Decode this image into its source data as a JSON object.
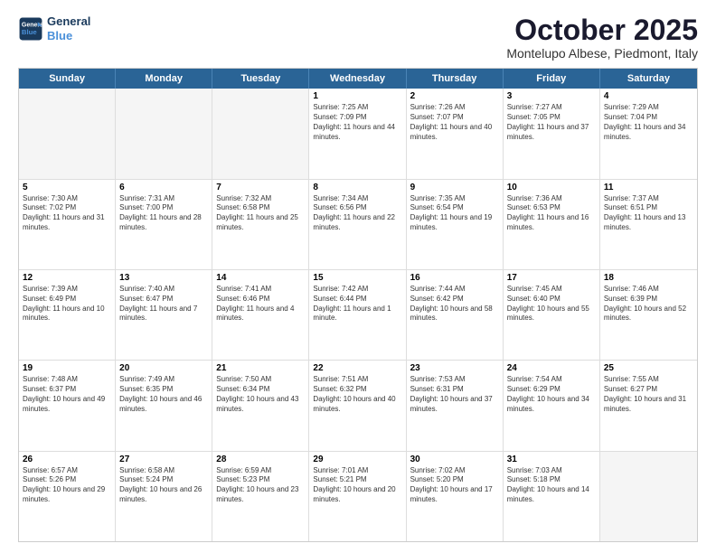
{
  "header": {
    "logo_line1": "General",
    "logo_line2": "Blue",
    "month": "October 2025",
    "location": "Montelupo Albese, Piedmont, Italy"
  },
  "days_of_week": [
    "Sunday",
    "Monday",
    "Tuesday",
    "Wednesday",
    "Thursday",
    "Friday",
    "Saturday"
  ],
  "rows": [
    [
      {
        "day": "",
        "text": "",
        "empty": true
      },
      {
        "day": "",
        "text": "",
        "empty": true
      },
      {
        "day": "",
        "text": "",
        "empty": true
      },
      {
        "day": "1",
        "text": "Sunrise: 7:25 AM\nSunset: 7:09 PM\nDaylight: 11 hours and 44 minutes."
      },
      {
        "day": "2",
        "text": "Sunrise: 7:26 AM\nSunset: 7:07 PM\nDaylight: 11 hours and 40 minutes."
      },
      {
        "day": "3",
        "text": "Sunrise: 7:27 AM\nSunset: 7:05 PM\nDaylight: 11 hours and 37 minutes."
      },
      {
        "day": "4",
        "text": "Sunrise: 7:29 AM\nSunset: 7:04 PM\nDaylight: 11 hours and 34 minutes."
      }
    ],
    [
      {
        "day": "5",
        "text": "Sunrise: 7:30 AM\nSunset: 7:02 PM\nDaylight: 11 hours and 31 minutes."
      },
      {
        "day": "6",
        "text": "Sunrise: 7:31 AM\nSunset: 7:00 PM\nDaylight: 11 hours and 28 minutes."
      },
      {
        "day": "7",
        "text": "Sunrise: 7:32 AM\nSunset: 6:58 PM\nDaylight: 11 hours and 25 minutes."
      },
      {
        "day": "8",
        "text": "Sunrise: 7:34 AM\nSunset: 6:56 PM\nDaylight: 11 hours and 22 minutes."
      },
      {
        "day": "9",
        "text": "Sunrise: 7:35 AM\nSunset: 6:54 PM\nDaylight: 11 hours and 19 minutes."
      },
      {
        "day": "10",
        "text": "Sunrise: 7:36 AM\nSunset: 6:53 PM\nDaylight: 11 hours and 16 minutes."
      },
      {
        "day": "11",
        "text": "Sunrise: 7:37 AM\nSunset: 6:51 PM\nDaylight: 11 hours and 13 minutes."
      }
    ],
    [
      {
        "day": "12",
        "text": "Sunrise: 7:39 AM\nSunset: 6:49 PM\nDaylight: 11 hours and 10 minutes."
      },
      {
        "day": "13",
        "text": "Sunrise: 7:40 AM\nSunset: 6:47 PM\nDaylight: 11 hours and 7 minutes."
      },
      {
        "day": "14",
        "text": "Sunrise: 7:41 AM\nSunset: 6:46 PM\nDaylight: 11 hours and 4 minutes."
      },
      {
        "day": "15",
        "text": "Sunrise: 7:42 AM\nSunset: 6:44 PM\nDaylight: 11 hours and 1 minute."
      },
      {
        "day": "16",
        "text": "Sunrise: 7:44 AM\nSunset: 6:42 PM\nDaylight: 10 hours and 58 minutes."
      },
      {
        "day": "17",
        "text": "Sunrise: 7:45 AM\nSunset: 6:40 PM\nDaylight: 10 hours and 55 minutes."
      },
      {
        "day": "18",
        "text": "Sunrise: 7:46 AM\nSunset: 6:39 PM\nDaylight: 10 hours and 52 minutes."
      }
    ],
    [
      {
        "day": "19",
        "text": "Sunrise: 7:48 AM\nSunset: 6:37 PM\nDaylight: 10 hours and 49 minutes."
      },
      {
        "day": "20",
        "text": "Sunrise: 7:49 AM\nSunset: 6:35 PM\nDaylight: 10 hours and 46 minutes."
      },
      {
        "day": "21",
        "text": "Sunrise: 7:50 AM\nSunset: 6:34 PM\nDaylight: 10 hours and 43 minutes."
      },
      {
        "day": "22",
        "text": "Sunrise: 7:51 AM\nSunset: 6:32 PM\nDaylight: 10 hours and 40 minutes."
      },
      {
        "day": "23",
        "text": "Sunrise: 7:53 AM\nSunset: 6:31 PM\nDaylight: 10 hours and 37 minutes."
      },
      {
        "day": "24",
        "text": "Sunrise: 7:54 AM\nSunset: 6:29 PM\nDaylight: 10 hours and 34 minutes."
      },
      {
        "day": "25",
        "text": "Sunrise: 7:55 AM\nSunset: 6:27 PM\nDaylight: 10 hours and 31 minutes."
      }
    ],
    [
      {
        "day": "26",
        "text": "Sunrise: 6:57 AM\nSunset: 5:26 PM\nDaylight: 10 hours and 29 minutes."
      },
      {
        "day": "27",
        "text": "Sunrise: 6:58 AM\nSunset: 5:24 PM\nDaylight: 10 hours and 26 minutes."
      },
      {
        "day": "28",
        "text": "Sunrise: 6:59 AM\nSunset: 5:23 PM\nDaylight: 10 hours and 23 minutes."
      },
      {
        "day": "29",
        "text": "Sunrise: 7:01 AM\nSunset: 5:21 PM\nDaylight: 10 hours and 20 minutes."
      },
      {
        "day": "30",
        "text": "Sunrise: 7:02 AM\nSunset: 5:20 PM\nDaylight: 10 hours and 17 minutes."
      },
      {
        "day": "31",
        "text": "Sunrise: 7:03 AM\nSunset: 5:18 PM\nDaylight: 10 hours and 14 minutes."
      },
      {
        "day": "",
        "text": "",
        "empty": true
      }
    ]
  ]
}
